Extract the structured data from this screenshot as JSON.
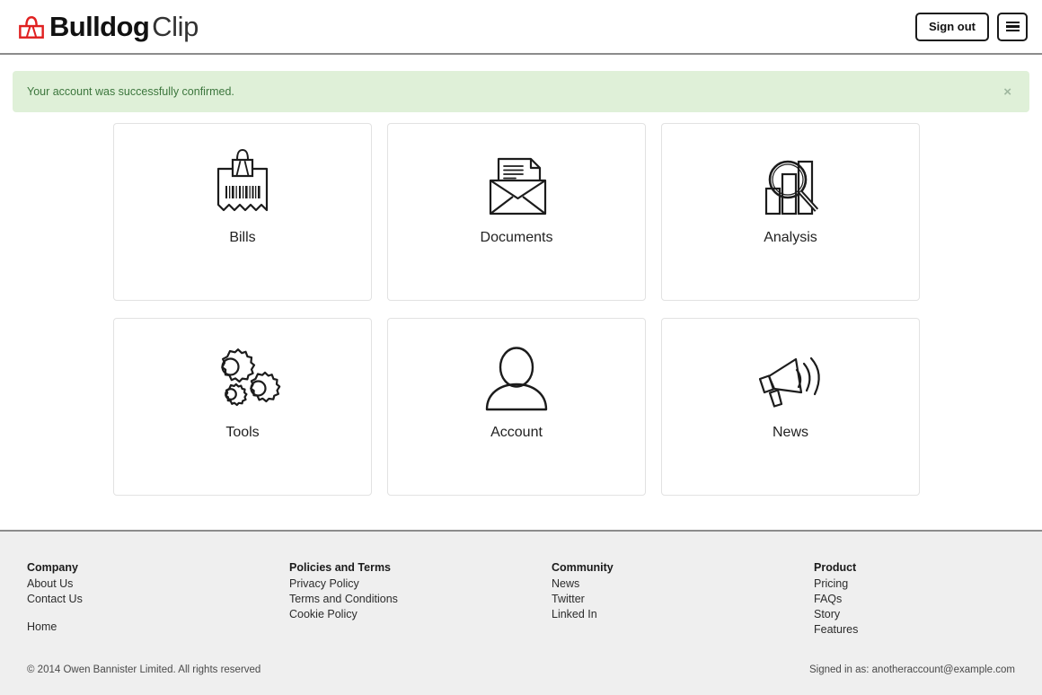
{
  "header": {
    "brand_strong": "Bulldog",
    "brand_light": "Clip",
    "brand_icon": "bulldog-clip-icon",
    "brand_color": "#e02020",
    "sign_out_label": "Sign out",
    "menu_icon": "hamburger-menu-icon"
  },
  "alert": {
    "message": "Your account was successfully confirmed.",
    "close_label": "×",
    "background": "#dff0d8",
    "text_color": "#3c763d"
  },
  "tiles": [
    {
      "label": "Bills",
      "icon": "receipt-with-clip-icon"
    },
    {
      "label": "Documents",
      "icon": "envelope-document-icon"
    },
    {
      "label": "Analysis",
      "icon": "bar-chart-magnifier-icon"
    },
    {
      "label": "Tools",
      "icon": "gears-icon"
    },
    {
      "label": "Account",
      "icon": "person-icon"
    },
    {
      "label": "News",
      "icon": "megaphone-icon"
    }
  ],
  "footer": {
    "columns": [
      {
        "title": "Company",
        "links": [
          "About Us",
          "Contact Us"
        ],
        "extra_links": [
          "Home"
        ]
      },
      {
        "title": "Policies and Terms",
        "links": [
          "Privacy Policy",
          "Terms and Conditions",
          "Cookie Policy"
        ],
        "extra_links": []
      },
      {
        "title": "Community",
        "links": [
          "News",
          "Twitter",
          "Linked In"
        ],
        "extra_links": []
      },
      {
        "title": "Product",
        "links": [
          "Pricing",
          "FAQs",
          "Story",
          "Features"
        ],
        "extra_links": []
      }
    ],
    "copyright": "© 2014 Owen Bannister Limited. All rights reserved",
    "signed_in": "Signed in as: anotheraccount@example.com"
  }
}
